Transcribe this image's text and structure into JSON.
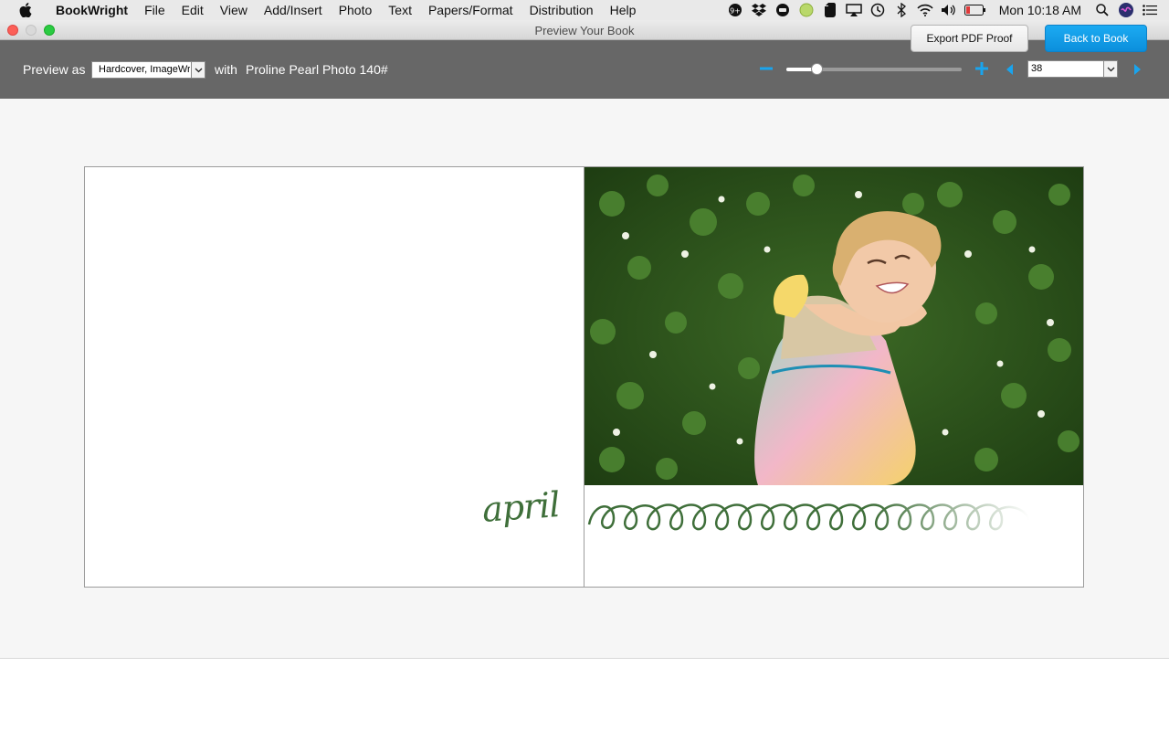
{
  "menubar": {
    "app_name": "BookWright",
    "items": [
      "File",
      "Edit",
      "View",
      "Add/Insert",
      "Photo",
      "Text",
      "Papers/Format",
      "Distribution",
      "Help"
    ],
    "clock": "Mon 10:18 AM"
  },
  "window": {
    "title": "Preview Your Book"
  },
  "toolbar": {
    "preview_as_label": "Preview as",
    "format_value": "Hardcover, ImageWrap",
    "with_label": "with",
    "paper": "Proline Pearl Photo 140#",
    "zoom_level": 0.15,
    "page_number": "38",
    "accent_color": "#19a4ee"
  },
  "spread": {
    "left_page_text": "april",
    "photo_description_icon": "photo-child-in-clover",
    "swirl_color": "#3f6f3a"
  },
  "footer": {
    "export_label": "Export PDF Proof",
    "back_label": "Back to Book"
  }
}
